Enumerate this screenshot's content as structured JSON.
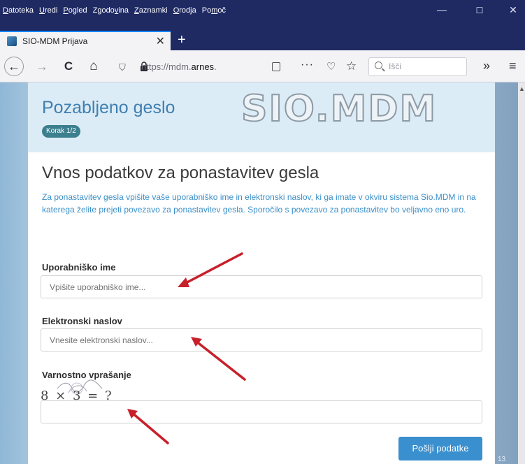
{
  "menubar": {
    "items": [
      {
        "underline": "D",
        "rest": "atoteka"
      },
      {
        "underline": "U",
        "rest": "redi"
      },
      {
        "underline": "P",
        "rest": "ogled"
      },
      {
        "underline": "",
        "rest": "Zgodo",
        "underline2": "v",
        "rest2": "ina"
      },
      {
        "underline": "Z",
        "rest": "aznamki"
      },
      {
        "underline": "O",
        "rest": "rodja"
      },
      {
        "underline": "",
        "rest": "Po",
        "underline2": "m",
        "rest2": "oč"
      }
    ],
    "minimize": "—",
    "maximize": "☐",
    "close": "✕"
  },
  "tab": {
    "title": "SIO-MDM Prijava",
    "close": "✕",
    "new_tab": "+"
  },
  "toolbar": {
    "back": "←",
    "forward": "→",
    "reload": "C",
    "home": "⌂",
    "url_prefix": "https://mdm.",
    "url_host": "arnes",
    "url_suffix": ".",
    "more": "···",
    "pocket": "♡",
    "star": "☆",
    "search_placeholder": "Išči",
    "overflow": "»",
    "menu": "≡"
  },
  "page": {
    "header_title": "Pozabljeno geslo",
    "step_badge": "Korak 1/2",
    "logo_text": "SIO.MDM",
    "heading": "Vnos podatkov za ponastavitev gesla",
    "intro": "Za ponastavitev gesla vpišite vaše uporabniško ime in elektronski naslov, ki ga imate v okviru sistema Sio.MDM in na katerega želite prejeti povezavo za ponastavitev gesla. Sporočilo s povezavo za ponastavitev bo veljavno eno uro.",
    "username_label": "Uporabniško ime",
    "username_placeholder": "Vpišite uporabniško ime...",
    "email_label": "Elektronski naslov",
    "email_placeholder": "Vnesite elektronski naslov...",
    "security_label": "Varnostno vprašanje",
    "captcha_text": "8 × 3 = ?",
    "submit_label": "Pošlji podatke",
    "page_number": "13"
  },
  "colors": {
    "titlebar": "#1f2a63",
    "accent": "#3a8fcf",
    "heading_blue": "#3f7fb0",
    "badge": "#3c7f8e",
    "annotation_arrow": "#c8202a"
  }
}
